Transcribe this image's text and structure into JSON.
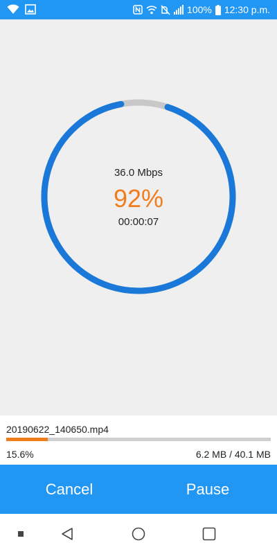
{
  "status_bar": {
    "battery": "100%",
    "time": "12:30 p.m.",
    "icons": [
      "wifi-icon",
      "image-icon",
      "nfc-icon",
      "wifi-calling-icon",
      "mute-icon",
      "signal-icon",
      "battery-icon"
    ]
  },
  "transfer": {
    "speed": "36.0 Mbps",
    "overall_percent_label": "92%",
    "overall_progress": 0.92,
    "elapsed": "00:00:07"
  },
  "file": {
    "name": "20190622_140650.mp4",
    "percent_label": "15.6%",
    "progress": 0.156,
    "size": "6.2 MB / 40.1 MB"
  },
  "actions": {
    "cancel_label": "Cancel",
    "pause_label": "Pause"
  },
  "nav": {
    "icons": [
      "recents-dot-icon",
      "back-icon",
      "home-icon",
      "overview-icon"
    ]
  },
  "colors": {
    "primary": "#2196f3",
    "ring_progress": "#1a78d8",
    "ring_track": "#c8c8c8",
    "accent": "#f07d1b",
    "background": "#efefef"
  }
}
